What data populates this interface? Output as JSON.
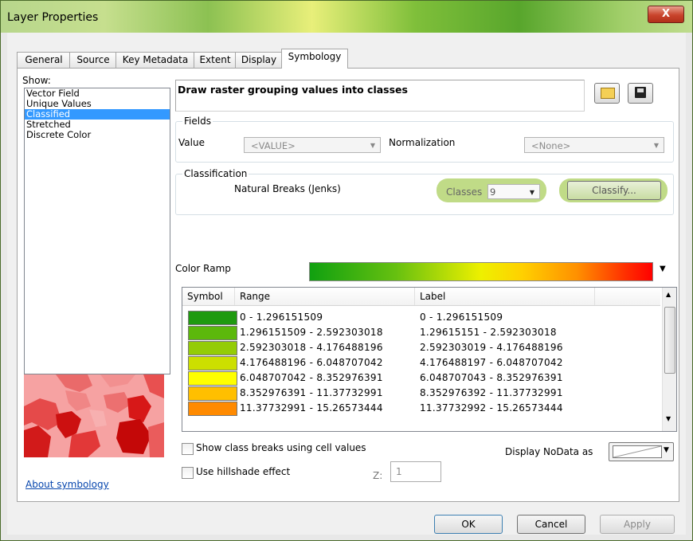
{
  "window": {
    "title": "Layer Properties",
    "close_label": "X"
  },
  "tabs": [
    "General",
    "Source",
    "Key Metadata",
    "Extent",
    "Display",
    "Symbology"
  ],
  "show": {
    "label": "Show:",
    "items": [
      "Vector Field",
      "Unique Values",
      "Classified",
      "Stretched",
      "Discrete Color"
    ],
    "selected": "Classified"
  },
  "description": "Draw raster grouping values into classes",
  "fields": {
    "legend": "Fields",
    "value_label": "Value",
    "value_selected": "<VALUE>",
    "normalization_label": "Normalization",
    "normalization_selected": "<None>"
  },
  "classification": {
    "legend": "Classification",
    "method": "Natural Breaks (Jenks)",
    "classes_label": "Classes",
    "classes_value": "9",
    "classify_label": "Classify..."
  },
  "color_ramp_label": "Color Ramp",
  "table": {
    "headers": [
      "Symbol",
      "Range",
      "Label"
    ],
    "rows": [
      {
        "color": "#1f9a10",
        "range": "0 - 1.296151509",
        "label": "0 - 1.296151509"
      },
      {
        "color": "#5cb80c",
        "range": "1.296151509 - 2.592303018",
        "label": "1.29615151 - 2.592303018"
      },
      {
        "color": "#94cc06",
        "range": "2.592303018 - 4.176488196",
        "label": "2.592303019 - 4.176488196"
      },
      {
        "color": "#ccdf00",
        "range": "4.176488196 - 6.048707042",
        "label": "4.176488197 - 6.048707042"
      },
      {
        "color": "#ffff00",
        "range": "6.048707042 - 8.352976391",
        "label": "6.048707043 - 8.352976391"
      },
      {
        "color": "#ffbf00",
        "range": "8.352976391 - 11.37732991",
        "label": "8.352976392 - 11.37732991"
      },
      {
        "color": "#ff8a00",
        "range": "11.37732991 - 15.26573444",
        "label": "11.37732992 - 15.26573444"
      }
    ]
  },
  "options": {
    "class_breaks_label": "Show class breaks using cell values",
    "hillshade_label": "Use hillshade effect",
    "z_label": "Z:",
    "z_value": "1",
    "nodata_label": "Display NoData as"
  },
  "about_label": "About symbology",
  "buttons": {
    "ok": "OK",
    "cancel": "Cancel",
    "apply": "Apply"
  }
}
